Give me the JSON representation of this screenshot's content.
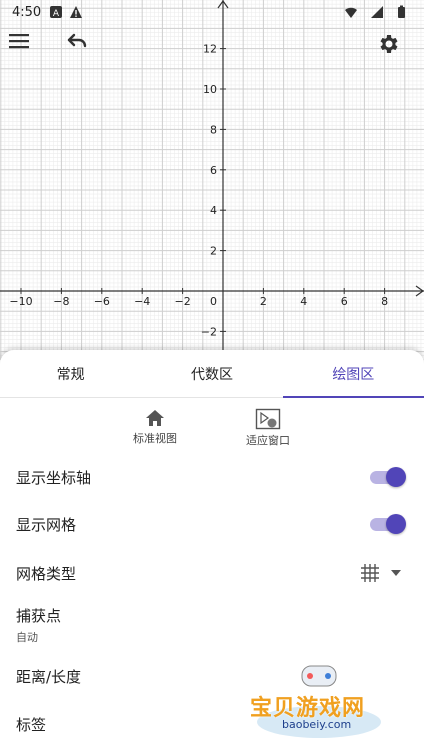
{
  "status_bar": {
    "time": "4:50",
    "icons": [
      "notification-a-icon",
      "warning-icon",
      "wifi-icon",
      "signal-icon",
      "battery-icon"
    ]
  },
  "toolbar": {
    "menu_icon": "hamburger-menu-icon",
    "undo_icon": "undo-icon",
    "settings_icon": "gear-icon"
  },
  "graph": {
    "x_ticks": [
      "−10",
      "−8",
      "−6",
      "−4",
      "−2",
      "0",
      "2",
      "4",
      "6",
      "8"
    ],
    "y_ticks": [
      "12",
      "10",
      "8",
      "6",
      "4",
      "2",
      "−2"
    ],
    "x_range": [
      -11,
      10
    ],
    "y_range": [
      -3,
      14
    ],
    "grid": true
  },
  "tabs": [
    {
      "label": "常规",
      "active": false
    },
    {
      "label": "代数区",
      "active": false
    },
    {
      "label": "绘图区",
      "active": true
    }
  ],
  "quick_actions": {
    "standard_view": {
      "label": "标准视图",
      "icon": "home-icon"
    },
    "fit_window": {
      "label": "适应窗口",
      "icon": "fit-window-icon"
    }
  },
  "settings": {
    "show_axes": {
      "label": "显示坐标轴",
      "on": true
    },
    "show_grid": {
      "label": "显示网格",
      "on": true
    },
    "grid_type": {
      "label": "网格类型",
      "icon": "grid-icon"
    },
    "snap_point": {
      "label": "捕获点",
      "value": "自动"
    },
    "distance": {
      "label": "距离/长度"
    },
    "labeling": {
      "label": "标签"
    }
  },
  "watermark": {
    "text": "宝贝游戏网",
    "url": "baobeiy.com"
  },
  "colors": {
    "accent": "#5145b8",
    "accent_light": "#b9b3e3",
    "grid_major": "#cfcfcf",
    "grid_minor": "#ececec"
  }
}
